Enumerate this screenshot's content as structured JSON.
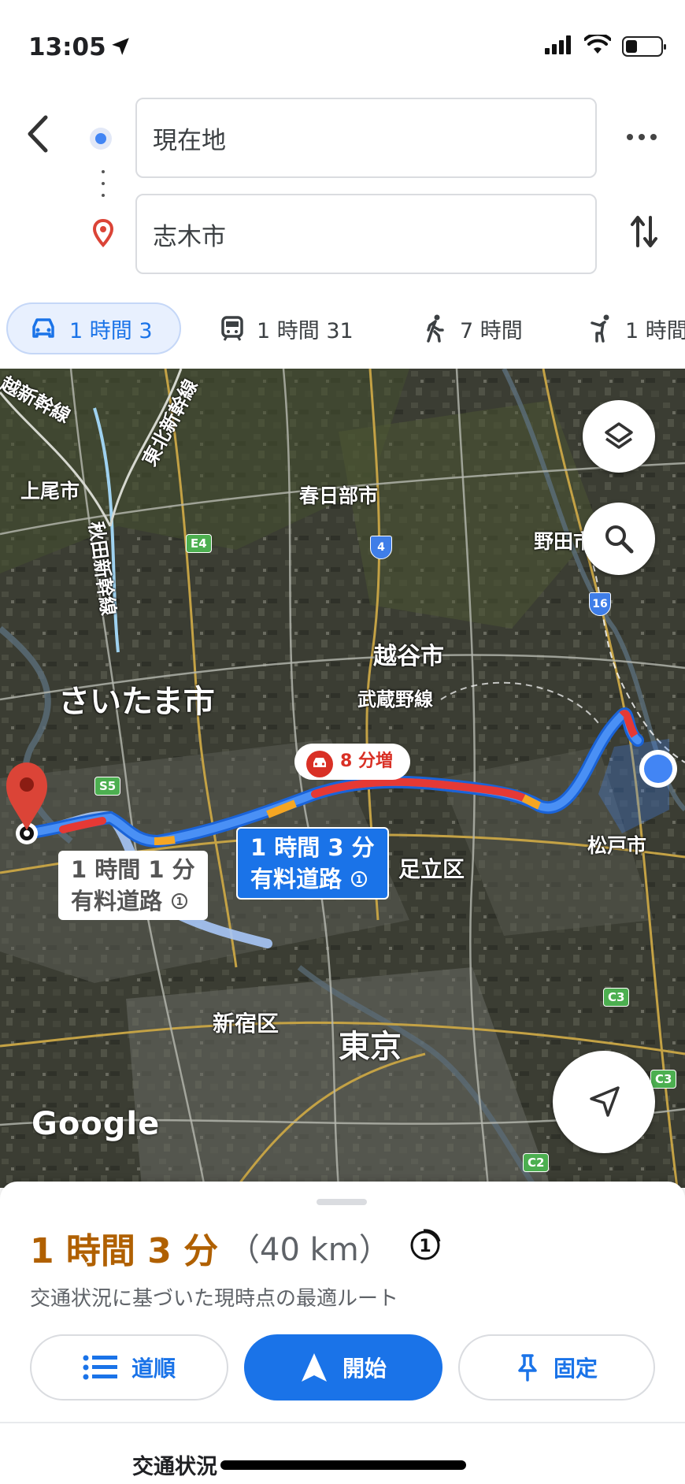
{
  "status_bar": {
    "time": "13:05",
    "battery_level": 0.3
  },
  "directions": {
    "origin": "現在地",
    "destination": "志木市"
  },
  "modes": [
    {
      "name": "car",
      "label": "1 時間 3",
      "active": true
    },
    {
      "name": "transit",
      "label": "1 時間 31",
      "active": false
    },
    {
      "name": "walk",
      "label": "7 時間",
      "active": false
    },
    {
      "name": "ride",
      "label": "1 時間",
      "active": false
    }
  ],
  "map": {
    "labels": {
      "joetsu_shinkansen": "越新幹線",
      "tohoku_shinkansen": "東北新幹線",
      "akita_shinkansen": "秋田新幹線",
      "ageo": "上尾市",
      "kasukabe": "春日部市",
      "noda": "野田市",
      "koshigaya": "越谷市",
      "musashino_line": "武蔵野線",
      "saitama": "さいたま市",
      "adachi": "足立区",
      "matsudo": "松戸市",
      "shinjuku": "新宿区",
      "tokyo": "東京"
    },
    "road_badges": [
      "E4",
      "S5",
      "C3",
      "C3",
      "C2"
    ],
    "route_badges": [
      "4",
      "16"
    ],
    "delay_label": "8 分増",
    "alt_route": {
      "time": "1 時間 1 分",
      "note": "有料道路"
    },
    "main_route": {
      "time": "1 時間 3 分",
      "note": "有料道路"
    },
    "attribution": "Google",
    "colors": {
      "route": "#4285f4",
      "traffic_heavy": "#e53935",
      "traffic_slow": "#f5a623",
      "destination_pin": "#db4437"
    }
  },
  "summary": {
    "duration": "1 時間 3 分",
    "distance": "（40 km）",
    "subtitle": "交通状況に基づいた現時点の最適ルート"
  },
  "actions": {
    "steps_label": "道順",
    "start_label": "開始",
    "pin_label": "固定"
  },
  "footer": {
    "traffic_label": "交通状況"
  }
}
